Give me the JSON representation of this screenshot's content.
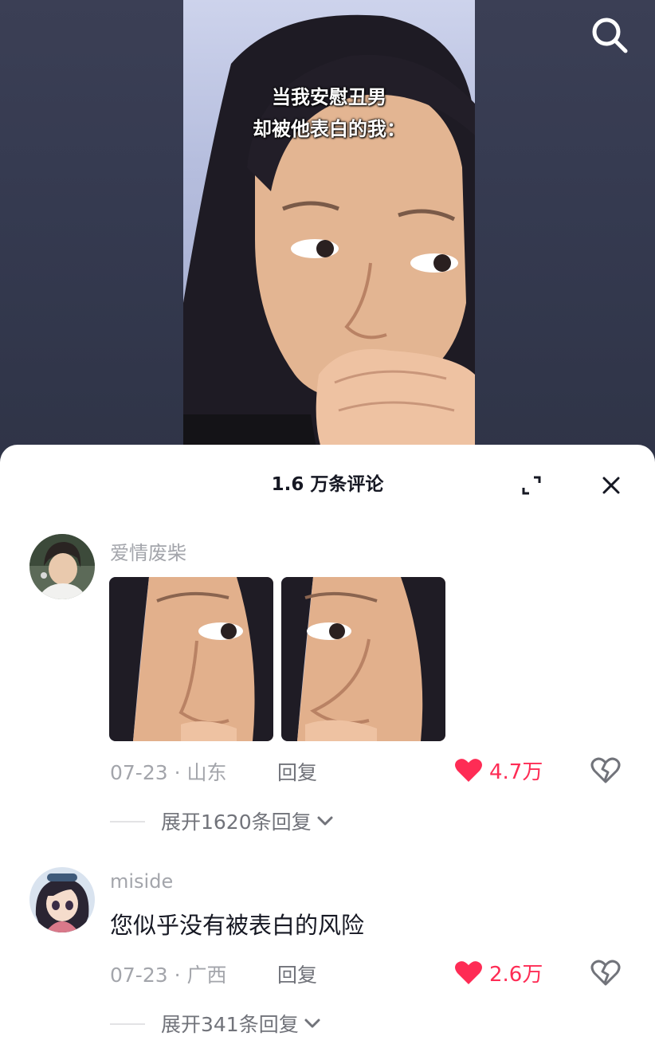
{
  "video": {
    "caption_line1": "当我安慰丑男",
    "caption_line2": "却被他表白的我："
  },
  "header": {
    "search_icon": "search-icon"
  },
  "sheet": {
    "title": "1.6 万条评论",
    "expand_icon": "expand-icon",
    "close_icon": "close-icon"
  },
  "comments": [
    {
      "username": "爱情废柴",
      "text": "",
      "images": 2,
      "meta": "07-23 · 山东",
      "reply": "回复",
      "likes": "4.7万",
      "expand_replies": "展开1620条回复"
    },
    {
      "username": "miside",
      "text": "您似乎没有被表白的风险",
      "images": 0,
      "meta": "07-23 · 广西",
      "reply": "回复",
      "likes": "2.6万",
      "expand_replies": "展开341条回复"
    }
  ],
  "colors": {
    "like": "#fe2c55",
    "muted": "#a3a5ab",
    "text": "#161823"
  }
}
